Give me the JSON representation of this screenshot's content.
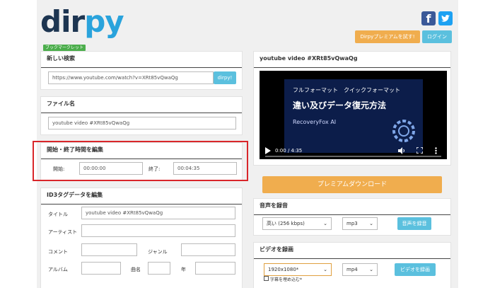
{
  "brand": {
    "logo_dark": "dir",
    "logo_light": "py",
    "bookmarklet": "ブックマークレット"
  },
  "social": {
    "facebook_icon": "facebook-icon",
    "twitter_icon": "twitter-icon"
  },
  "header": {
    "premium_label": "Dirpyプレミアムを試す!",
    "login_label": "ログイン"
  },
  "new_search": {
    "title": "新しい検索",
    "url": "https://www.youtube.com/watch?v=XRt85vQwaQg",
    "button": "dirpy!"
  },
  "file_name": {
    "title": "ファイル名",
    "value": "youtube video #XRt85vQwaQg"
  },
  "time_edit": {
    "title": "開始・終了時間を編集",
    "start_label": "開始:",
    "start_value": "00:00:00",
    "end_label": "終了:",
    "end_value": "00:04:35"
  },
  "id3": {
    "title": "ID3タグデータを編集",
    "title_label": "タイトル",
    "title_value": "youtube video #XRt85vQwaQg",
    "artist_label": "アーティスト",
    "comment_label": "コメント",
    "genre_label": "ジャンル",
    "album_label": "アルバム",
    "track_label": "曲名",
    "year_label": "年"
  },
  "video_panel": {
    "title": "youtube video #XRt85vQwaQg",
    "thumb_line1": "フルフォーマット　クイックフォーマット",
    "thumb_line2": "違い及びデータ復元方法",
    "thumb_brand": "RecoveryFox AI",
    "time": "0:00 / 4:35"
  },
  "premium_download": "プレミアムダウンロード",
  "audio": {
    "title": "音声を録音",
    "quality": "高い (256 kbps)",
    "format": "mp3",
    "button": "音声を録音"
  },
  "video": {
    "title": "ビデオを録画",
    "resolution": "1920x1080*",
    "format": "mp4",
    "button": "ビデオを録画",
    "subtitle_label": "字幕を埋め込む*"
  },
  "colors": {
    "accent_blue": "#5bc0de",
    "orange": "#f0ad4e",
    "highlight": "#d9262a"
  }
}
